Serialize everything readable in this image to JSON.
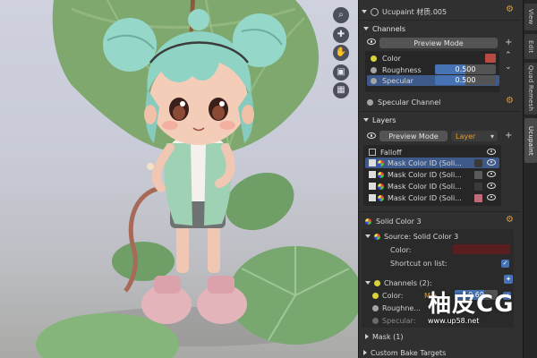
{
  "header": {
    "material_name": "Ucupaint 材质.005"
  },
  "viewport": {
    "tool_icons": [
      "zoom-icon",
      "pan-icon",
      "hand-icon",
      "camera-icon",
      "grid-icon"
    ]
  },
  "tabs": {
    "items": [
      "View",
      "Edit",
      "Quad Remesh",
      "Ucupaint"
    ]
  },
  "channels": {
    "section_label": "Channels",
    "preview_label": "Preview Mode",
    "items": [
      {
        "label": "Color",
        "value": ""
      },
      {
        "label": "Roughness",
        "value": "0.500"
      },
      {
        "label": "Specular",
        "value": "0.500"
      }
    ],
    "specular_channel_label": "Specular Channel"
  },
  "layers": {
    "section_label": "Layers",
    "preview_label": "Preview Mode",
    "layer_dropdown": "Layer",
    "items": [
      {
        "label": "Falloff",
        "swatch": ""
      },
      {
        "label": "Mask Color ID (Soli...",
        "swatch": "#3a3a3a"
      },
      {
        "label": "Mask Color ID (Soli...",
        "swatch": "#5a5a5a"
      },
      {
        "label": "Mask Color ID (Soli...",
        "swatch": "#3a3a3a"
      },
      {
        "label": "Mask Color ID (Soli...",
        "swatch": "#c16b78"
      }
    ]
  },
  "solid_color": {
    "title": "Solid Color 3",
    "source_label": "Source: Solid Color 3",
    "color_label": "Color:",
    "color_value": "#5b1e1e",
    "shortcut_label": "Shortcut on list:",
    "channels_label": "Channels (2):",
    "color_row_label": "Color:",
    "color_row_mode": "Mix",
    "color_row_value": "0.69",
    "roughness_label": "Roughne...",
    "specular_label": "Specular:"
  },
  "mask": {
    "label": "Mask (1)"
  },
  "bake": {
    "label": "Custom Bake Targets"
  },
  "watermark": {
    "logo": "CG",
    "url": "www.up58.net"
  },
  "colors": {
    "accent": "#4772b3",
    "gear": "#e89a2c",
    "panel": "#303030"
  }
}
